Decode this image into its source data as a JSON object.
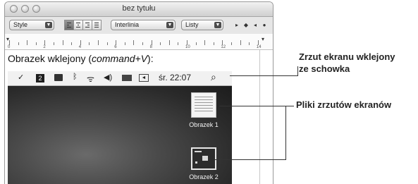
{
  "window": {
    "title": "bez tytułu"
  },
  "toolbar": {
    "style_label": "Style",
    "spacing_label": "Interlinia",
    "lists_label": "Listy",
    "spacing_controls": [
      "▸",
      "◆",
      "◂",
      "●"
    ]
  },
  "ruler": {
    "numbers": [
      "0",
      "2",
      "4",
      "6",
      "8",
      "10",
      "12",
      "14"
    ]
  },
  "document": {
    "caption_text": "Obrazek wklejony (",
    "caption_em": "command+V",
    "caption_end": "):"
  },
  "menubar": {
    "box_label": "2",
    "clock": "śr. 22:07",
    "search_glyph": "⌕"
  },
  "desktop": {
    "files": [
      {
        "label": "Obrazek 1"
      },
      {
        "label": "Obrazek 2"
      }
    ]
  },
  "callouts": {
    "clipboard_line1": "Zrzut ekranu wklejony",
    "clipboard_line2": "ze schowka",
    "files_label": "Pliki zrzutów ekranów"
  }
}
